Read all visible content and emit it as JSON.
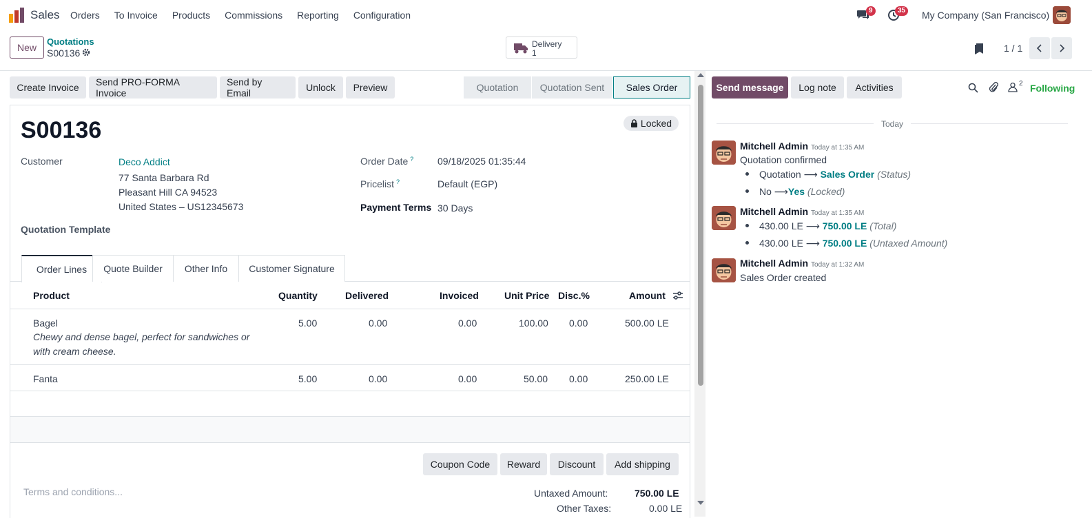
{
  "app": {
    "name": "Sales"
  },
  "menu": [
    "Orders",
    "To Invoice",
    "Products",
    "Commissions",
    "Reporting",
    "Configuration"
  ],
  "systray": {
    "messages_count": "9",
    "activities_count": "35",
    "company": "My Company (San Francisco)"
  },
  "control": {
    "new_label": "New",
    "breadcrumb_parent": "Quotations",
    "breadcrumb_current": "S00136",
    "smart_button": {
      "label": "Delivery",
      "count": "1"
    },
    "pager": "1 / 1"
  },
  "actions": [
    "Create Invoice",
    "Send PRO-FORMA Invoice",
    "Send by Email",
    "Unlock",
    "Preview"
  ],
  "stages": [
    "Quotation",
    "Quotation Sent",
    "Sales Order"
  ],
  "record": {
    "name": "S00136",
    "locked_label": "Locked",
    "customer_label": "Customer",
    "customer_name": "Deco Addict",
    "address_1": "77 Santa Barbara Rd",
    "address_2": "Pleasant Hill CA 94523",
    "address_3": "United States – US12345673",
    "template_label": "Quotation Template",
    "order_date_label": "Order Date",
    "order_date": "09/18/2025 01:35:44",
    "pricelist_label": "Pricelist",
    "pricelist": "Default (EGP)",
    "payment_terms_label": "Payment Terms",
    "payment_terms": "30 Days",
    "help_mark": "?"
  },
  "tabs": [
    "Order Lines",
    "Quote Builder",
    "Other Info",
    "Customer Signature"
  ],
  "lines": {
    "headers": {
      "product": "Product",
      "quantity": "Quantity",
      "delivered": "Delivered",
      "invoiced": "Invoiced",
      "unit_price": "Unit Price",
      "discount": "Disc.%",
      "amount": "Amount"
    },
    "rows": [
      {
        "product": "Bagel",
        "desc_1": "Chewy and dense bagel, perfect for sandwiches or",
        "desc_2": "with cream cheese.",
        "quantity": "5.00",
        "delivered": "0.00",
        "invoiced": "0.00",
        "unit_price": "100.00",
        "discount": "0.00",
        "amount": "500.00 LE"
      },
      {
        "product": "Fanta",
        "quantity": "5.00",
        "delivered": "0.00",
        "invoiced": "0.00",
        "unit_price": "50.00",
        "discount": "0.00",
        "amount": "250.00 LE"
      }
    ]
  },
  "bottom_buttons": [
    "Coupon Code",
    "Reward",
    "Discount",
    "Add shipping"
  ],
  "terms_placeholder": "Terms and conditions...",
  "totals": {
    "untaxed_label": "Untaxed Amount:",
    "untaxed": "750.00 LE",
    "taxes_label": "Other Taxes:",
    "taxes": "0.00 LE"
  },
  "chatter": {
    "send_message": "Send message",
    "log_note": "Log note",
    "activities": "Activities",
    "followers_count": "2",
    "following": "Following",
    "date_separator": "Today",
    "messages": [
      {
        "author": "Mitchell Admin",
        "time": "Today at 1:35 AM",
        "text": "Quotation confirmed",
        "changes": [
          {
            "old": "Quotation",
            "new": "Sales Order",
            "field": "(Status)"
          },
          {
            "old": "No",
            "new": "Yes",
            "field": "(Locked)"
          }
        ]
      },
      {
        "author": "Mitchell Admin",
        "time": "Today at 1:35 AM",
        "changes": [
          {
            "old": "430.00 LE",
            "new": "750.00 LE",
            "field": "(Total)"
          },
          {
            "old": "430.00 LE",
            "new": "750.00 LE",
            "field": "(Untaxed Amount)"
          }
        ]
      },
      {
        "author": "Mitchell Admin",
        "time": "Today at 1:32 AM",
        "text": "Sales Order created"
      }
    ]
  },
  "colors": {
    "brand": "#714b67",
    "link": "#017e84",
    "badge": "#d2334a",
    "following": "#28a745"
  },
  "icons": [
    "sales-app-icon",
    "chat-icon",
    "clock-icon",
    "truck-icon",
    "gear-icon",
    "bookmark-icon",
    "chevron-left-icon",
    "chevron-right-icon",
    "lock-icon",
    "settings-sliders-icon",
    "search-icon",
    "paperclip-icon",
    "user-icon",
    "arrow-right-icon"
  ]
}
